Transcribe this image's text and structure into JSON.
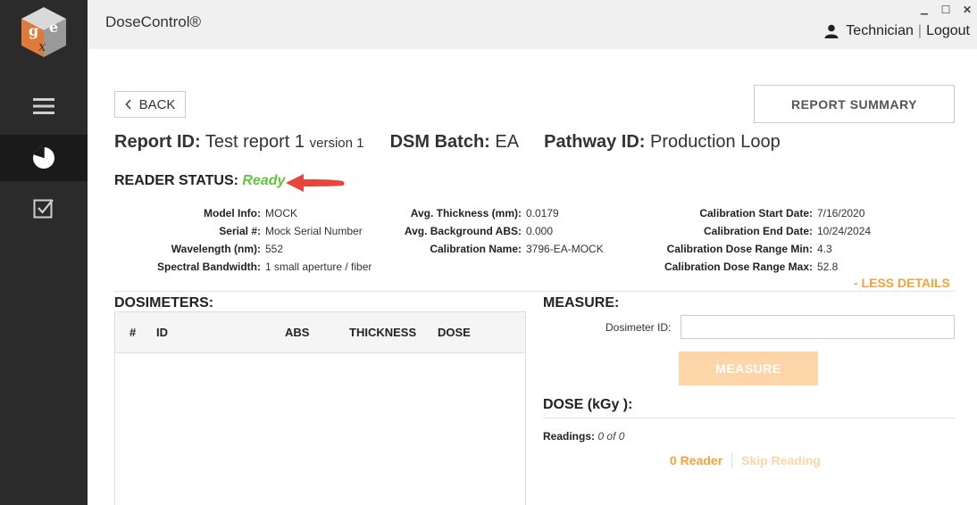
{
  "titlebar": {
    "app_title": "DoseControl®",
    "minimize": "▁",
    "maximize": "☐",
    "close": "✕",
    "user": "Technician",
    "separator": "|",
    "logout": "Logout",
    "user_icon": "user-icon"
  },
  "sidebar": {
    "logo_letters": [
      "g",
      "e",
      "x"
    ],
    "items": [
      {
        "icon": "menu-icon"
      },
      {
        "icon": "pie-chart-icon",
        "active": true
      },
      {
        "icon": "checkbox-icon"
      }
    ]
  },
  "nav": {
    "back_label": "BACK",
    "report_summary_label": "REPORT SUMMARY"
  },
  "report": {
    "id_label": "Report ID:",
    "id_value": "Test report 1",
    "version": "version 1",
    "batch_label": "DSM Batch:",
    "batch_value": "EA",
    "pathway_label": "Pathway ID:",
    "pathway_value": "Production Loop"
  },
  "reader_status": {
    "label": "READER STATUS:",
    "value": "Ready",
    "value_color": "#62c43a"
  },
  "details": {
    "col1": [
      {
        "label": "Model Info:",
        "value": "MOCK"
      },
      {
        "label": "Serial #:",
        "value": "Mock Serial Number"
      },
      {
        "label": "Wavelength (nm):",
        "value": "552"
      },
      {
        "label": "Spectral Bandwidth:",
        "value": "1 small aperture / fiber"
      }
    ],
    "col2": [
      {
        "label": "Avg. Thickness (mm):",
        "value": "0.0179"
      },
      {
        "label": "Avg. Background ABS:",
        "value": "0.000"
      },
      {
        "label": "Calibration Name:",
        "value": "3796-EA-MOCK"
      }
    ],
    "col3": [
      {
        "label": "Calibration Start Date:",
        "value": "7/16/2020"
      },
      {
        "label": "Calibration End Date:",
        "value": "10/24/2024"
      },
      {
        "label": "Calibration Dose Range Min:",
        "value": "4.3"
      },
      {
        "label": "Calibration Dose Range Max:",
        "value": "52.8"
      }
    ],
    "toggle_label": "- LESS DETAILS"
  },
  "dosimeters": {
    "title": "DOSIMETERS:",
    "columns": [
      "#",
      "ID",
      "ABS",
      "THICKNESS",
      "DOSE"
    ],
    "rows": []
  },
  "measure": {
    "title": "MEASURE:",
    "dosimeter_id_label": "Dosimeter ID:",
    "dosimeter_id_value": "",
    "button_label": "MEASURE"
  },
  "dose": {
    "title": "DOSE (kGy ):",
    "readings_label": "Readings:",
    "readings_count": "0",
    "readings_of": "of",
    "readings_total": "0",
    "reader_link": "0 Reader",
    "skip_link": "Skip Reading"
  },
  "colors": {
    "accent": "#f5a13b",
    "accent_light": "#fcd6a9",
    "sidebar_bg": "#2b2b2b",
    "arrow": "#e8453c"
  }
}
